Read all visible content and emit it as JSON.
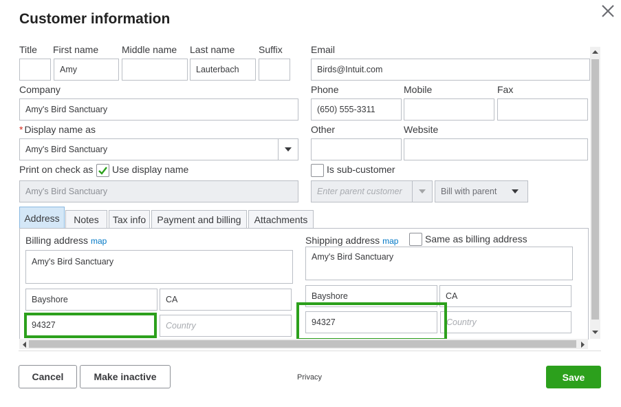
{
  "dialog": {
    "title": "Customer information"
  },
  "name": {
    "title_label": "Title",
    "title_value": "",
    "first_label": "First name",
    "first_value": "Amy",
    "middle_label": "Middle name",
    "middle_value": "",
    "last_label": "Last name",
    "last_value": "Lauterbach",
    "suffix_label": "Suffix",
    "suffix_value": ""
  },
  "email": {
    "label": "Email",
    "value": "Birds@Intuit.com"
  },
  "company": {
    "label": "Company",
    "value": "Amy's Bird Sanctuary"
  },
  "phone": {
    "label": "Phone",
    "value": "(650) 555-3311"
  },
  "mobile": {
    "label": "Mobile",
    "value": ""
  },
  "fax": {
    "label": "Fax",
    "value": ""
  },
  "display_name": {
    "required_mark": "*",
    "label": "Display name as",
    "value": "Amy's Bird Sanctuary"
  },
  "other": {
    "label": "Other",
    "value": ""
  },
  "website": {
    "label": "Website",
    "value": ""
  },
  "print_check": {
    "label": "Print on check as",
    "checkbox_label": "Use display name",
    "checked": true,
    "value": "Amy's Bird Sanctuary"
  },
  "sub_customer": {
    "label": "Is sub-customer",
    "checked": false,
    "parent_placeholder": "Enter parent customer",
    "bill_with": "Bill with parent"
  },
  "tabs": [
    "Address",
    "Notes",
    "Tax info",
    "Payment and billing",
    "Attachments"
  ],
  "billing": {
    "label": "Billing address",
    "map_link": "map",
    "street": "Amy's Bird Sanctuary",
    "city": "Bayshore",
    "state": "CA",
    "zip": "94327",
    "country_placeholder": "Country"
  },
  "shipping": {
    "label": "Shipping address",
    "map_link": "map",
    "same_as_label": "Same as billing address",
    "street": "Amy's Bird Sanctuary",
    "city": "Bayshore",
    "state": "CA",
    "zip": "94327",
    "country_placeholder": "Country"
  },
  "footer": {
    "cancel": "Cancel",
    "make_inactive": "Make inactive",
    "privacy": "Privacy",
    "save": "Save"
  },
  "colors": {
    "accent_green": "#2ca01c",
    "link_blue": "#0077c5",
    "required_red": "#d52b1e"
  }
}
